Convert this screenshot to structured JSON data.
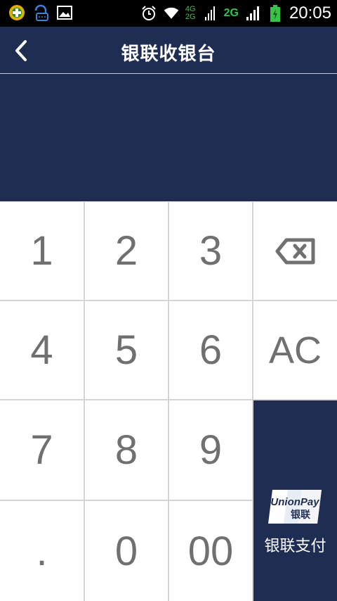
{
  "status_bar": {
    "time": "20:05",
    "network_top": "4G",
    "network_bottom": "2G",
    "network_2g": "2G",
    "icons": [
      "app-icon",
      "chat-notification-icon",
      "image-icon",
      "alarm-icon",
      "wifi-icon",
      "signal-icon",
      "battery-icon"
    ]
  },
  "header": {
    "title": "银联收银台",
    "back_icon": "chevron-left-icon"
  },
  "amount": {
    "value": ""
  },
  "keypad": {
    "keys": {
      "k1": "1",
      "k2": "2",
      "k3": "3",
      "k4": "4",
      "k5": "5",
      "k6": "6",
      "k7": "7",
      "k8": "8",
      "k9": "9",
      "dot": ".",
      "k0": "0",
      "k00": "00",
      "clear": "AC"
    },
    "backspace_icon": "backspace-icon",
    "pay": {
      "label": "银联支付",
      "logo_text_top": "UnionPay",
      "logo_text_bottom": "银联"
    }
  },
  "colors": {
    "primary": "#1f2d52",
    "key_bg": "#ffffff",
    "key_text": "#707070",
    "divider": "#d4d4d4"
  }
}
